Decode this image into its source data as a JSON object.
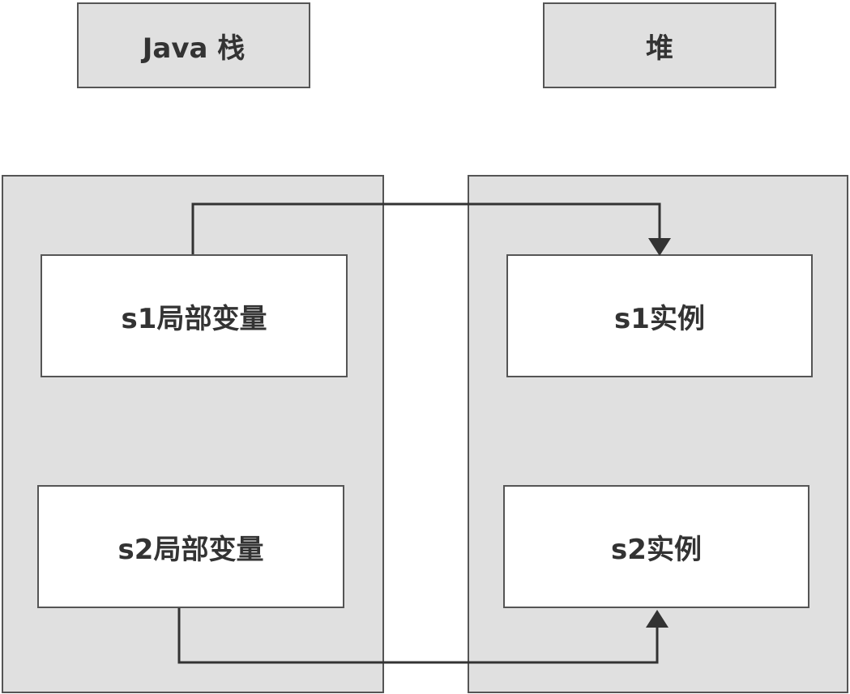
{
  "headers": {
    "stack": "Java 栈",
    "heap": "堆"
  },
  "stack": {
    "s1": "s1局部变量",
    "s2": "s2局部变量"
  },
  "heap": {
    "s1": "s1实例",
    "s2": "s2实例"
  },
  "colors": {
    "panel_fill": "#e0e0e0",
    "border": "#555555",
    "box_fill": "#ffffff",
    "arrow": "#333333",
    "text": "#333333"
  }
}
